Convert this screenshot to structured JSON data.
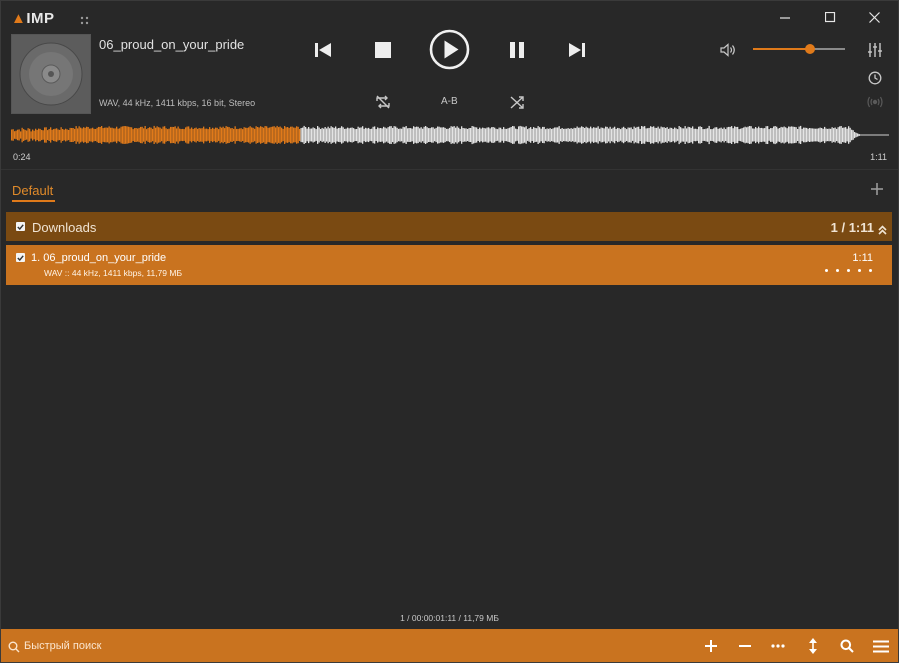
{
  "app": {
    "logo_text": "IMP"
  },
  "track": {
    "title": "06_proud_on_your_pride",
    "info": "WAV, 44 kHz, 1411 kbps, 16 bit, Stereo",
    "elapsed": "0:24",
    "duration": "1:11",
    "progress_fraction": 0.34
  },
  "controls": {
    "ab_label": "A-B",
    "volume_fraction": 0.62
  },
  "playlist": {
    "tabs": [
      {
        "label": "Default"
      }
    ],
    "group": {
      "title": "Downloads",
      "stats": "1 / 1:11"
    },
    "items": [
      {
        "title": "1. 06_proud_on_your_pride",
        "info": "WAV :: 44 kHz, 1411 kbps, 11,79 МБ",
        "duration": "1:11"
      }
    ]
  },
  "status": {
    "text": "1 / 00:00:01:11 / 11,79 МБ"
  },
  "search": {
    "placeholder": "Быстрый поиск"
  },
  "colors": {
    "accent": "#e07a1a",
    "row_selected": "#c9731f",
    "group_header": "#7a4a12",
    "background": "#282828"
  }
}
